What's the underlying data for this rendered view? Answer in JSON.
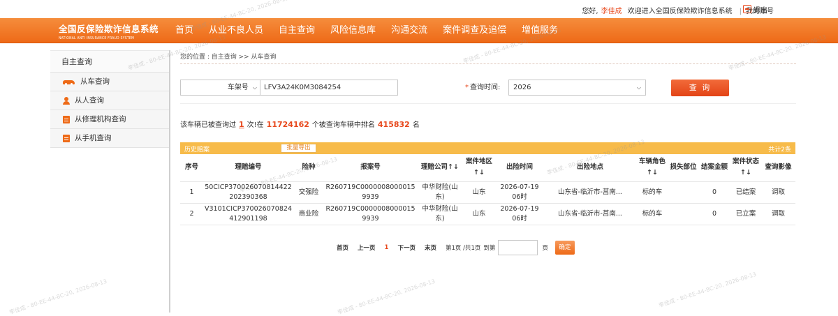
{
  "topbar": {
    "greeting": "您好,",
    "user": "李佳成",
    "welcome": "欢迎进入全国反保险欺诈信息系统",
    "account": "我的账号",
    "logout": "退出"
  },
  "logo": {
    "cn": "全国反保险欺诈信息系统",
    "en": "NATIONAL ANTI INSURANCE FRAUD SYSTEM"
  },
  "nav": [
    "首页",
    "从业不良人员",
    "自主查询",
    "风险信息库",
    "沟通交流",
    "案件调查及追偿",
    "增值服务"
  ],
  "sidebar": {
    "title": "自主查询",
    "items": [
      {
        "label": "从车查询",
        "icon": "car-icon"
      },
      {
        "label": "从人查询",
        "icon": "person-icon"
      },
      {
        "label": "从修理机构查询",
        "icon": "document-icon"
      },
      {
        "label": "从手机查询",
        "icon": "document-icon"
      }
    ]
  },
  "breadcrumb": "您的位置 : 自主查询 >> 从车查询",
  "search": {
    "type_value": "车架号",
    "vin_value": "LFV3A24K0M3084254",
    "time_label": "查询时间:",
    "time_value": "2026",
    "button": "查 询"
  },
  "stat": {
    "p1": "该车辆已被查询过",
    "count": "1",
    "p2": "次!在",
    "total": "11724162",
    "p3": "个被查询车辆中排名",
    "rank": "415832",
    "p4": "名"
  },
  "history": {
    "title": "历史赔案",
    "export": "批量导出",
    "total": "共计2条",
    "headers": [
      "序号",
      "理赔编号",
      "险种",
      "报案号",
      "理赔公司↑↓",
      "案件地区↑↓",
      "出险时间",
      "出险地点",
      "车辆角色↑↓",
      "损失部位",
      "结案金额",
      "案件状态↑↓",
      "查询影像"
    ],
    "rows": [
      [
        "1",
        "50CICP370026070814422202390368",
        "交强险",
        "R260719C00000080000159939",
        "中华财险(山东)",
        "山东",
        "2026-07-19 06时",
        "山东省-临沂市-莒南...",
        "标的车",
        "",
        "0",
        "已结案",
        "调取"
      ],
      [
        "2",
        "V3101CICP370026070824412901198",
        "商业险",
        "R260719C00000080000159939",
        "中华财险(山东)",
        "山东",
        "2026-07-19 06时",
        "山东省-临沂市-莒南...",
        "标的车",
        "",
        "0",
        "已立案",
        "调取"
      ]
    ]
  },
  "pager": {
    "first": "首页",
    "prev": "上一页",
    "current": "1",
    "next": "下一页",
    "last": "末页",
    "info": "第1页 /共1页",
    "goto": "到第",
    "page_unit": "页",
    "confirm": "确定"
  },
  "watermark": "李佳成 - 80-EE-44-8C-20, 2026-08-13",
  "colors": {
    "brand": "#ee6a17",
    "accent": "#e8491d",
    "table_header": "#f7bb4a"
  }
}
